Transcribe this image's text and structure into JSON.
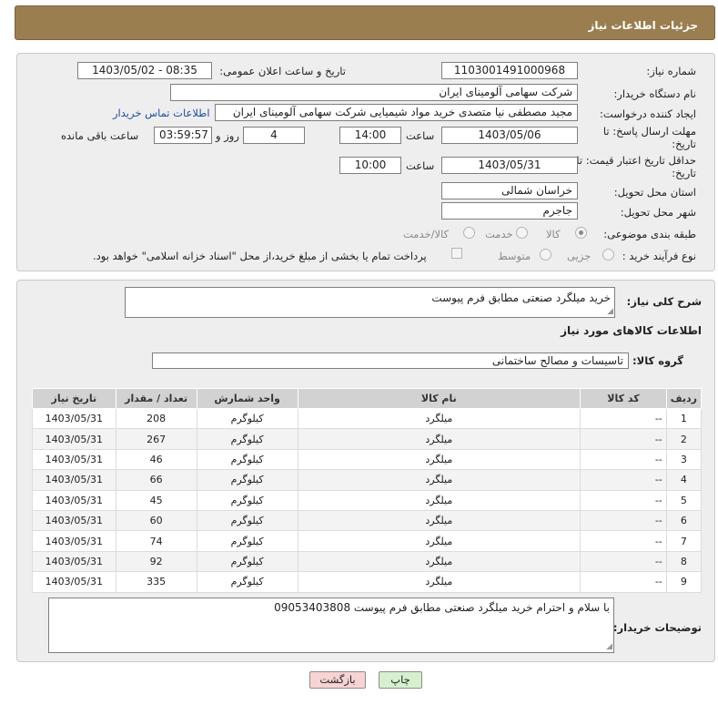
{
  "header": {
    "title": "جزئیات اطلاعات نیاز"
  },
  "form": {
    "need_number_label": "شماره نیاز:",
    "need_number": "1103001491000968",
    "announce_label": "تاریخ و ساعت اعلان عمومی:",
    "announce_value": "1403/05/02 - 08:35",
    "buyer_org_label": "نام دستگاه خریدار:",
    "buyer_org": "شرکت سهامی آلومینای ایران",
    "creator_label": "ایجاد کننده درخواست:",
    "creator": "مجید مصطفی نیا متصدی خرید مواد شیمیایی شرکت سهامی آلومینای ایران",
    "contact_link": "اطلاعات تماس خریدار",
    "deadline_label_1": "مهلت ارسال پاسخ: تا",
    "deadline_label_2": "تاریخ:",
    "deadline_date": "1403/05/06",
    "hour_label": "ساعت",
    "deadline_time": "14:00",
    "days_value": "4",
    "days_label": "روز و",
    "remaining_value": "03:59:57",
    "remaining_label": "ساعت باقی مانده",
    "validity_label_1": "حداقل تاریخ اعتبار قیمت: تا",
    "validity_label_2": "تاریخ:",
    "validity_date": "1403/05/31",
    "validity_time": "10:00",
    "province_label": "استان محل تحویل:",
    "province": "خراسان شمالی",
    "city_label": "شهر محل تحویل:",
    "city": "جاجرم",
    "category_label": "طبقه بندی موضوعی:",
    "category_options": [
      "کالا",
      "خدمت",
      "کالا/خدمت"
    ],
    "process_label": "نوع فرآیند خرید :",
    "process_options": [
      "جزیی",
      "متوسط"
    ],
    "payment_note": "پرداخت تمام یا بخشی از مبلغ خرید،از محل \"اسناد خزانه اسلامی\" خواهد بود."
  },
  "details": {
    "summary_label": "شرح کلی نیاز:",
    "summary": "خرید میلگرد صنعتی مطابق فرم پیوست",
    "goods_info_title": "اطلاعات کالاهای مورد نیاز",
    "goods_group_label": "گروه کالا:",
    "goods_group": "تاسیسات و مصالح ساختمانی",
    "buyer_notes_label": "توضیحات خریدار:",
    "buyer_notes": "با سلام و احترام خرید میلگرد صنعتی مطابق فرم پیوست 09053403808"
  },
  "table": {
    "headers": [
      "ردیف",
      "کد کالا",
      "نام کالا",
      "واحد شمارش",
      "تعداد / مقدار",
      "تاریخ نیاز"
    ],
    "rows": [
      [
        "1",
        "--",
        "میلگرد",
        "کیلوگرم",
        "208",
        "1403/05/31"
      ],
      [
        "2",
        "--",
        "میلگرد",
        "کیلوگرم",
        "267",
        "1403/05/31"
      ],
      [
        "3",
        "--",
        "میلگرد",
        "کیلوگرم",
        "46",
        "1403/05/31"
      ],
      [
        "4",
        "--",
        "میلگرد",
        "کیلوگرم",
        "66",
        "1403/05/31"
      ],
      [
        "5",
        "--",
        "میلگرد",
        "کیلوگرم",
        "45",
        "1403/05/31"
      ],
      [
        "6",
        "--",
        "میلگرد",
        "کیلوگرم",
        "60",
        "1403/05/31"
      ],
      [
        "7",
        "--",
        "میلگرد",
        "کیلوگرم",
        "74",
        "1403/05/31"
      ],
      [
        "8",
        "--",
        "میلگرد",
        "کیلوگرم",
        "92",
        "1403/05/31"
      ],
      [
        "9",
        "--",
        "میلگرد",
        "کیلوگرم",
        "335",
        "1403/05/31"
      ]
    ]
  },
  "buttons": {
    "print": "چاپ",
    "back": "بازگشت"
  },
  "colors": {
    "header_bg": "#9b7e4f",
    "print_bg": "#d6f0cf",
    "back_bg": "#f7d3d3"
  }
}
